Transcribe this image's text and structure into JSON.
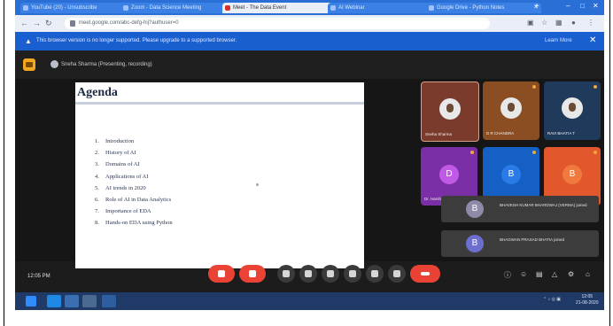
{
  "browser": {
    "tabs": [
      {
        "label": "YouTube (20) - Unsubscribe"
      },
      {
        "label": "Zoom - Data Science Meeting"
      },
      {
        "label": "Meet - The Data Event"
      },
      {
        "label": "AI Webinar"
      },
      {
        "label": "Google Drive - Python Notes"
      }
    ],
    "url": "meet.google.com/abc-defg-hij?authuser=0"
  },
  "infobar": {
    "message": "This browser version is no longer supported. Please upgrade to a supported browser.",
    "learn_more": "Learn More"
  },
  "meeting": {
    "title": "Sneha Sharma (Presenting, recording)",
    "time": "12:05 PM"
  },
  "slide": {
    "title": "Agenda",
    "items": [
      {
        "num": "1.",
        "text": "Introduction"
      },
      {
        "num": "2.",
        "text": "History of AI"
      },
      {
        "num": "3.",
        "text": "Domains of AI"
      },
      {
        "num": "4.",
        "text": "Applications of AI"
      },
      {
        "num": "5.",
        "text": "AI trends in 2020"
      },
      {
        "num": "6.",
        "text": "Role of AI in Data Analytics"
      },
      {
        "num": "7.",
        "text": "Importance of EDA"
      },
      {
        "num": "8.",
        "text": "Hands-on EDA using Python"
      }
    ]
  },
  "participants": [
    {
      "name": "Sneha Sharma",
      "avatar": "photo",
      "color": "#7a3a2c"
    },
    {
      "name": "D R CHANDRA",
      "avatar": "photo",
      "color": "#8a4e22"
    },
    {
      "name": "RAVI BHATIA T",
      "avatar": "photo",
      "color": "#1f3a5a"
    },
    {
      "name": "Dr. Harsha",
      "avatar": "D",
      "color": "#7b2fa6"
    },
    {
      "name": "Bhavesh",
      "avatar": "B",
      "color": "#1460c4"
    },
    {
      "name": "",
      "avatar": "B",
      "color": "#e2572c"
    }
  ],
  "notifications": [
    {
      "avatar": "B",
      "text": "BHAVESH KUMAR BHARDWAJ (VERMA) joined"
    },
    {
      "avatar": "B",
      "text": "BHAGWAN PRASAD BHATIA joined"
    }
  ],
  "taskbar": {
    "clock_time": "12:05",
    "clock_date": "21-08-2020"
  }
}
